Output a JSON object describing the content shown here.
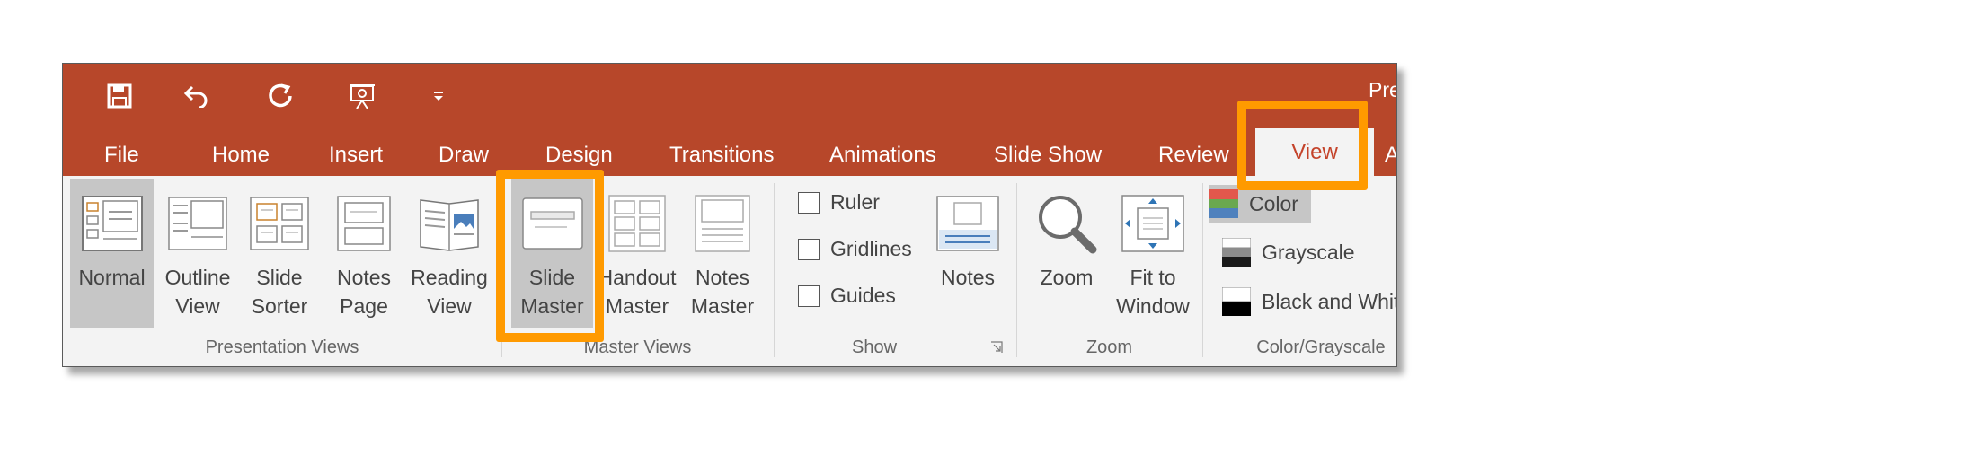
{
  "title_fragment": "Pre",
  "qat": [
    {
      "name": "save-icon"
    },
    {
      "name": "undo-icon"
    },
    {
      "name": "redo-icon"
    },
    {
      "name": "present-from-start-icon"
    },
    {
      "name": "customize-qat-icon"
    }
  ],
  "tabs": [
    "File",
    "Home",
    "Insert",
    "Draw",
    "Design",
    "Transitions",
    "Animations",
    "Slide Show",
    "Review",
    "View",
    "A"
  ],
  "active_tab": "View",
  "groups": {
    "presentation_views": {
      "label": "Presentation Views",
      "buttons": [
        {
          "line1": "Normal",
          "line2": ""
        },
        {
          "line1": "Outline",
          "line2": "View"
        },
        {
          "line1": "Slide",
          "line2": "Sorter"
        },
        {
          "line1": "Notes",
          "line2": "Page"
        },
        {
          "line1": "Reading",
          "line2": "View"
        }
      ]
    },
    "master_views": {
      "label": "Master Views",
      "buttons": [
        {
          "line1": "Slide",
          "line2": "Master"
        },
        {
          "line1": "Handout",
          "line2": "Master"
        },
        {
          "line1": "Notes",
          "line2": "Master"
        }
      ]
    },
    "show": {
      "label": "Show",
      "checks": [
        "Ruler",
        "Gridlines",
        "Guides"
      ],
      "notes_button": "Notes"
    },
    "zoom": {
      "label": "Zoom",
      "zoom_button": "Zoom",
      "fit_line1": "Fit to",
      "fit_line2": "Window"
    },
    "color": {
      "label": "Color/Grayscale",
      "options": [
        "Color",
        "Grayscale",
        "Black and Whit"
      ]
    }
  },
  "colors": {
    "ribbon_accent": "#b7472a",
    "highlight": "#ff9a00",
    "active_tab_text": "#c4432a"
  }
}
